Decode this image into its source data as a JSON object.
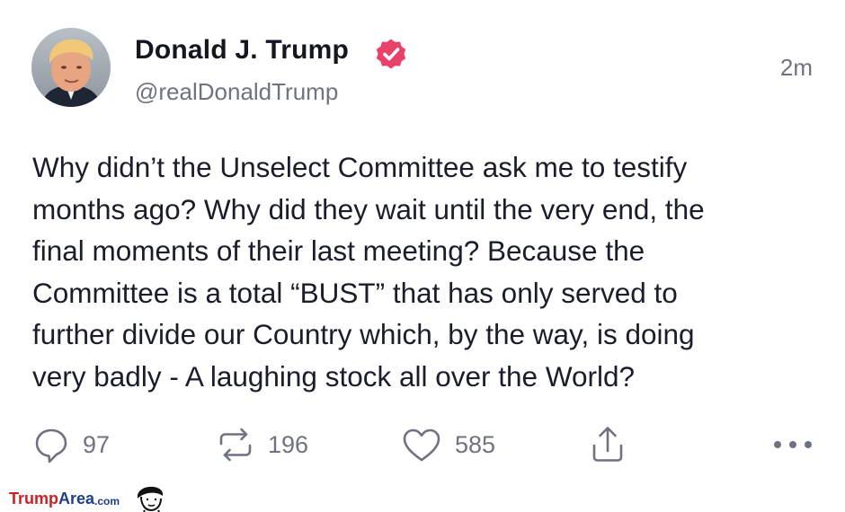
{
  "post": {
    "author": {
      "name": "Donald J. Trump",
      "handle": "@realDonaldTrump",
      "verified": true
    },
    "timestamp": "2m",
    "body_lines": [
      "Why didn’t the Unselect Committee ask me to testify",
      "months ago? Why did they wait until the very end, the",
      "final moments of their last meeting? Because the",
      "Committee is a total “BUST” that has only served to",
      "further divide our Country which, by the way, is doing",
      "very badly - A laughing stock all over the World?"
    ],
    "actions": {
      "reply": {
        "icon": "reply-icon",
        "count": "97"
      },
      "repost": {
        "icon": "repost-icon",
        "count": "196"
      },
      "like": {
        "icon": "heart-icon",
        "count": "585"
      },
      "share": {
        "icon": "share-icon"
      },
      "more": {
        "icon": "more-icon"
      }
    }
  },
  "watermark": {
    "part1": "Trump",
    "part2": "Area",
    "part3": ".com"
  },
  "colors": {
    "text": "#1a1d2a",
    "muted": "#6f7280",
    "verified_badge": "#e8426a",
    "watermark_red": "#cf1f24",
    "watermark_blue": "#1f3f8c"
  }
}
